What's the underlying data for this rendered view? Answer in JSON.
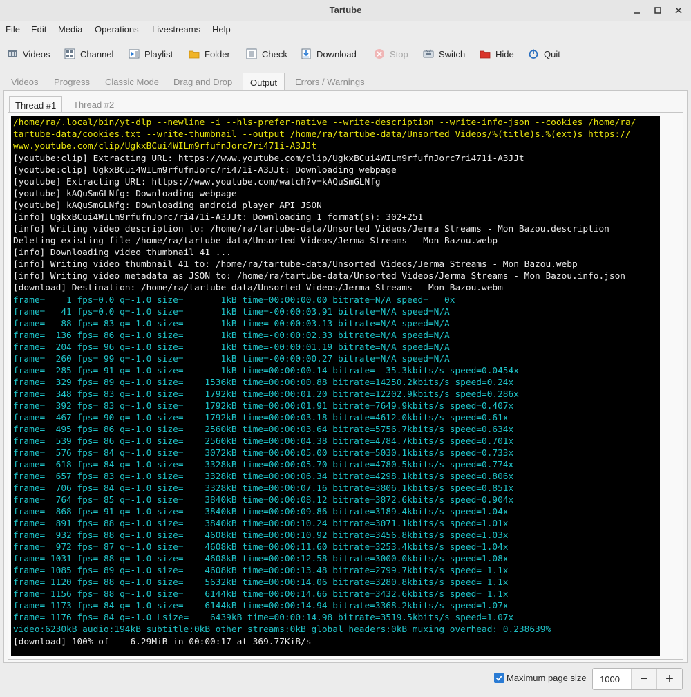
{
  "window": {
    "title": "Tartube"
  },
  "menu": [
    "File",
    "Edit",
    "Media",
    "Operations",
    "Livestreams",
    "Help"
  ],
  "toolbar": {
    "videos": "Videos",
    "channel": "Channel",
    "playlist": "Playlist",
    "folder": "Folder",
    "check": "Check",
    "download": "Download",
    "stop": "Stop",
    "switch": "Switch",
    "hide": "Hide",
    "quit": "Quit"
  },
  "tabs": [
    "Videos",
    "Progress",
    "Classic Mode",
    "Drag and Drop",
    "Output",
    "Errors / Warnings"
  ],
  "active_tab": "Output",
  "subtabs": [
    "Thread #1",
    "Thread #2"
  ],
  "terminal": {
    "command": "/home/ra/.local/bin/yt-dlp --newline -i --hls-prefer-native --write-description --write-info-json --cookies /home/ra/\ntartube-data/cookies.txt --write-thumbnail --output /home/ra/tartube-data/Unsorted Videos/%(title)s.%(ext)s https://\nwww.youtube.com/clip/UgkxBCui4WILm9rfufnJorc7ri471i-A3JJt",
    "log": "[youtube:clip] Extracting URL: https://www.youtube.com/clip/UgkxBCui4WILm9rfufnJorc7ri471i-A3JJt\n[youtube:clip] UgkxBCui4WILm9rfufnJorc7ri471i-A3JJt: Downloading webpage\n[youtube] Extracting URL: https://www.youtube.com/watch?v=kAQuSmGLNfg\n[youtube] kAQuSmGLNfg: Downloading webpage\n[youtube] kAQuSmGLNfg: Downloading android player API JSON\n[info] UgkxBCui4WILm9rfufnJorc7ri471i-A3JJt: Downloading 1 format(s): 302+251\n[info] Writing video description to: /home/ra/tartube-data/Unsorted Videos/Jerma Streams - Mon Bazou.description\nDeleting existing file /home/ra/tartube-data/Unsorted Videos/Jerma Streams - Mon Bazou.webp\n[info] Downloading video thumbnail 41 ...\n[info] Writing video thumbnail 41 to: /home/ra/tartube-data/Unsorted Videos/Jerma Streams - Mon Bazou.webp\n[info] Writing video metadata as JSON to: /home/ra/tartube-data/Unsorted Videos/Jerma Streams - Mon Bazou.info.json\n[download] Destination: /home/ra/tartube-data/Unsorted Videos/Jerma Streams - Mon Bazou.webm",
    "progress": "frame=    1 fps=0.0 q=-1.0 size=       1kB time=00:00:00.00 bitrate=N/A speed=   0x\nframe=   41 fps=0.0 q=-1.0 size=       1kB time=-00:00:03.91 bitrate=N/A speed=N/A\nframe=   88 fps= 83 q=-1.0 size=       1kB time=-00:00:03.13 bitrate=N/A speed=N/A\nframe=  136 fps= 86 q=-1.0 size=       1kB time=-00:00:02.33 bitrate=N/A speed=N/A\nframe=  204 fps= 96 q=-1.0 size=       1kB time=-00:00:01.19 bitrate=N/A speed=N/A\nframe=  260 fps= 99 q=-1.0 size=       1kB time=-00:00:00.27 bitrate=N/A speed=N/A\nframe=  285 fps= 91 q=-1.0 size=       1kB time=00:00:00.14 bitrate=  35.3kbits/s speed=0.0454x\nframe=  329 fps= 89 q=-1.0 size=    1536kB time=00:00:00.88 bitrate=14250.2kbits/s speed=0.24x\nframe=  348 fps= 83 q=-1.0 size=    1792kB time=00:00:01.20 bitrate=12202.9kbits/s speed=0.286x\nframe=  392 fps= 83 q=-1.0 size=    1792kB time=00:00:01.91 bitrate=7649.9kbits/s speed=0.407x\nframe=  467 fps= 90 q=-1.0 size=    1792kB time=00:00:03.18 bitrate=4612.0kbits/s speed=0.61x\nframe=  495 fps= 86 q=-1.0 size=    2560kB time=00:00:03.64 bitrate=5756.7kbits/s speed=0.634x\nframe=  539 fps= 86 q=-1.0 size=    2560kB time=00:00:04.38 bitrate=4784.7kbits/s speed=0.701x\nframe=  576 fps= 84 q=-1.0 size=    3072kB time=00:00:05.00 bitrate=5030.1kbits/s speed=0.733x\nframe=  618 fps= 84 q=-1.0 size=    3328kB time=00:00:05.70 bitrate=4780.5kbits/s speed=0.774x\nframe=  657 fps= 83 q=-1.0 size=    3328kB time=00:00:06.34 bitrate=4298.1kbits/s speed=0.806x\nframe=  706 fps= 84 q=-1.0 size=    3328kB time=00:00:07.16 bitrate=3806.1kbits/s speed=0.851x\nframe=  764 fps= 85 q=-1.0 size=    3840kB time=00:00:08.12 bitrate=3872.6kbits/s speed=0.904x\nframe=  868 fps= 91 q=-1.0 size=    3840kB time=00:00:09.86 bitrate=3189.4kbits/s speed=1.04x\nframe=  891 fps= 88 q=-1.0 size=    3840kB time=00:00:10.24 bitrate=3071.1kbits/s speed=1.01x\nframe=  932 fps= 88 q=-1.0 size=    4608kB time=00:00:10.92 bitrate=3456.8kbits/s speed=1.03x\nframe=  972 fps= 87 q=-1.0 size=    4608kB time=00:00:11.60 bitrate=3253.4kbits/s speed=1.04x\nframe= 1031 fps= 88 q=-1.0 size=    4608kB time=00:00:12.58 bitrate=3000.0kbits/s speed=1.08x\nframe= 1085 fps= 89 q=-1.0 size=    4608kB time=00:00:13.48 bitrate=2799.7kbits/s speed= 1.1x\nframe= 1120 fps= 88 q=-1.0 size=    5632kB time=00:00:14.06 bitrate=3280.8kbits/s speed= 1.1x\nframe= 1156 fps= 88 q=-1.0 size=    6144kB time=00:00:14.66 bitrate=3432.6kbits/s speed= 1.1x\nframe= 1173 fps= 84 q=-1.0 size=    6144kB time=00:00:14.94 bitrate=3368.2kbits/s speed=1.07x\nframe= 1176 fps= 84 q=-1.0 Lsize=    6439kB time=00:00:14.98 bitrate=3519.5kbits/s speed=1.07x\nvideo:6230kB audio:194kB subtitle:0kB other streams:0kB global headers:0kB muxing overhead: 0.238639%",
    "final": "[download] 100% of    6.29MiB in 00:00:17 at 369.77KiB/s"
  },
  "footer": {
    "max_page_label": "Maximum page size",
    "max_page_checked": true,
    "page_size": "1000",
    "minus": "−",
    "plus": "+"
  },
  "colors": {
    "command": "#e8e30d",
    "log": "#eaeaea",
    "progress": "#1ec3c8",
    "checkbox": "#2a7bd4"
  }
}
